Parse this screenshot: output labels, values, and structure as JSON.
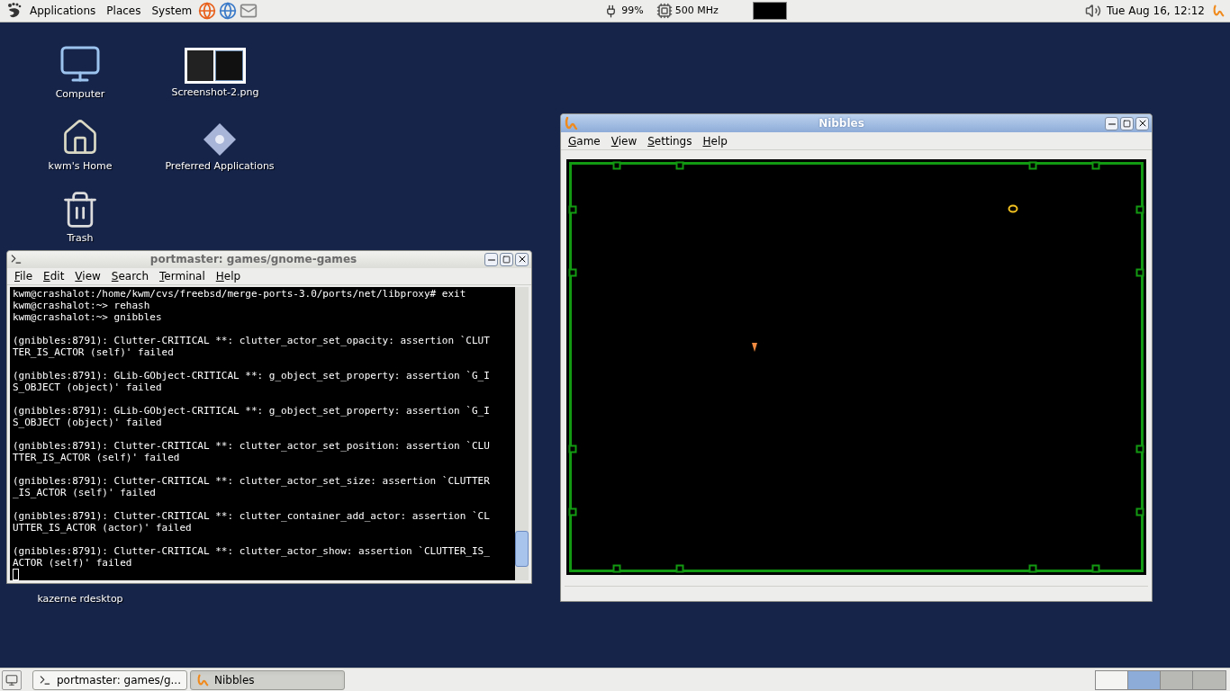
{
  "top_panel": {
    "menus": [
      "Applications",
      "Places",
      "System"
    ],
    "battery": "99%",
    "cpu_speed": "500 MHz",
    "clock": "Tue Aug 16, 12:12"
  },
  "desktop_icons": [
    {
      "kind": "computer",
      "label": "Computer"
    },
    {
      "kind": "image",
      "label": "Screenshot-2.png"
    },
    {
      "kind": "home",
      "label": "kwm's Home"
    },
    {
      "kind": "preferences",
      "label": "Preferred Applications"
    },
    {
      "kind": "trash",
      "label": "Trash"
    },
    {
      "kind": "hidden",
      "label": "kazerne rdesktop"
    }
  ],
  "terminal": {
    "title": "portmaster: games/gnome-games",
    "active": false,
    "menus": [
      "File",
      "Edit",
      "View",
      "Search",
      "Terminal",
      "Help"
    ],
    "output": [
      [
        "kwm@crashalot:/home/kwm/cvs/freebsd/merge-ports-3.0/ports/net/libproxy# exit",
        "kwm@crashalot:~> rehash",
        "kwm@crashalot:~> gnibbles"
      ],
      [
        "(gnibbles:8791): Clutter-CRITICAL **: clutter_actor_set_opacity: assertion `CLUT",
        "TER_IS_ACTOR (self)' failed"
      ],
      [
        "(gnibbles:8791): GLib-GObject-CRITICAL **: g_object_set_property: assertion `G_I",
        "S_OBJECT (object)' failed"
      ],
      [
        "(gnibbles:8791): GLib-GObject-CRITICAL **: g_object_set_property: assertion `G_I",
        "S_OBJECT (object)' failed"
      ],
      [
        "(gnibbles:8791): Clutter-CRITICAL **: clutter_actor_set_position: assertion `CLU",
        "TTER_IS_ACTOR (self)' failed"
      ],
      [
        "(gnibbles:8791): Clutter-CRITICAL **: clutter_actor_set_size: assertion `CLUTTER",
        "_IS_ACTOR (self)' failed"
      ],
      [
        "(gnibbles:8791): Clutter-CRITICAL **: clutter_container_add_actor: assertion `CL",
        "UTTER_IS_ACTOR (actor)' failed"
      ],
      [
        "(gnibbles:8791): Clutter-CRITICAL **: clutter_actor_show: assertion `CLUTTER_IS_",
        "ACTOR (self)' failed"
      ]
    ]
  },
  "nibbles": {
    "title": "Nibbles",
    "active": true,
    "menus": [
      "Game",
      "View",
      "Settings",
      "Help"
    ]
  },
  "taskbar": [
    {
      "kind": "terminal",
      "label": "portmaster: games/g...",
      "selected": false
    },
    {
      "kind": "nibbles",
      "label": "Nibbles",
      "selected": true
    }
  ]
}
